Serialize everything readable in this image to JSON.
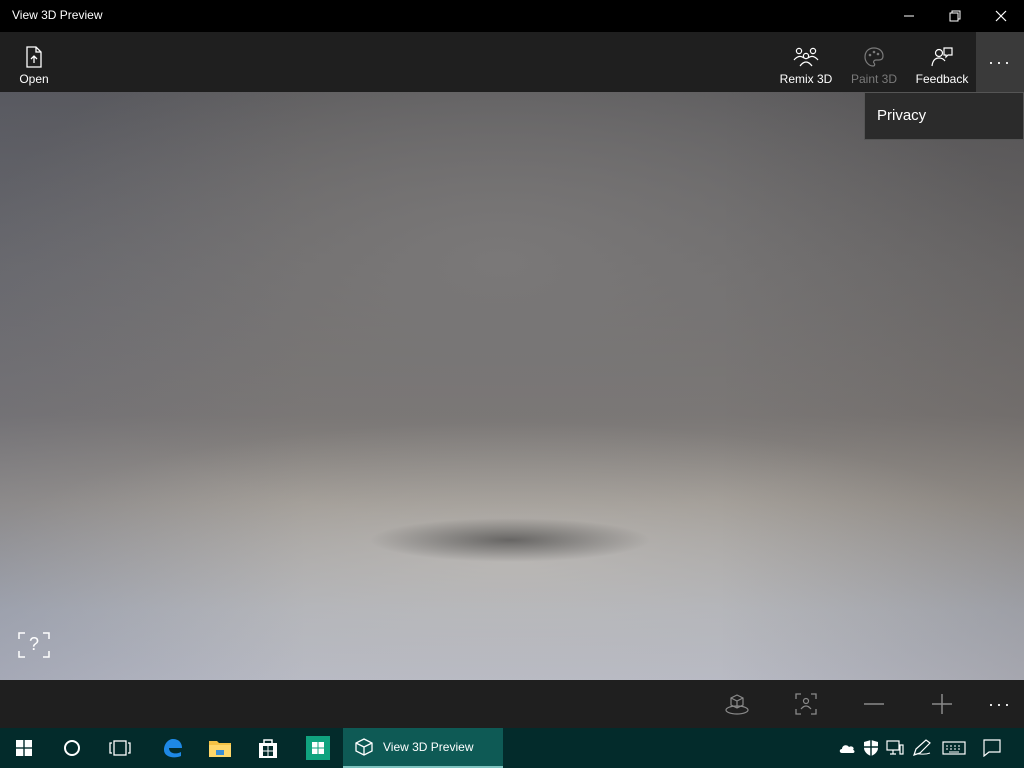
{
  "window": {
    "title": "View 3D Preview",
    "minimize_glyph": "—",
    "restore_glyph": "❐",
    "close_glyph": "✕"
  },
  "toolbar": {
    "open_label": "Open",
    "remix_label": "Remix 3D",
    "paint_label": "Paint 3D",
    "feedback_label": "Feedback",
    "more_label": "···"
  },
  "menu": {
    "items": [
      {
        "label": "Privacy"
      }
    ]
  },
  "viewport": {
    "help_label": "?"
  },
  "bottombar": {
    "more_label": "···"
  },
  "taskbar": {
    "active_app_label": "View 3D Preview"
  },
  "colors": {
    "titlebar": "#000000",
    "toolbar": "#1f1f1f",
    "taskbar": "#032b2b",
    "taskbar_active": "#0e5a55",
    "edge_blue": "#1e88e5"
  },
  "icons": {
    "toolbar": [
      "open-file-icon",
      "remix-3d-icon",
      "paint-3d-icon",
      "feedback-icon"
    ],
    "bottombar": [
      "mixed-reality-icon",
      "fit-view-icon",
      "zoom-out-icon",
      "zoom-in-icon"
    ],
    "taskbar": [
      "windows-start-icon",
      "cortana-icon",
      "task-view-icon",
      "edge-icon",
      "file-explorer-icon",
      "store-icon",
      "start-tiles-icon",
      "view3d-app-icon"
    ],
    "tray": [
      "onedrive-icon",
      "defender-icon",
      "network-icon",
      "pen-icon",
      "keyboard-icon",
      "action-center-icon"
    ]
  }
}
